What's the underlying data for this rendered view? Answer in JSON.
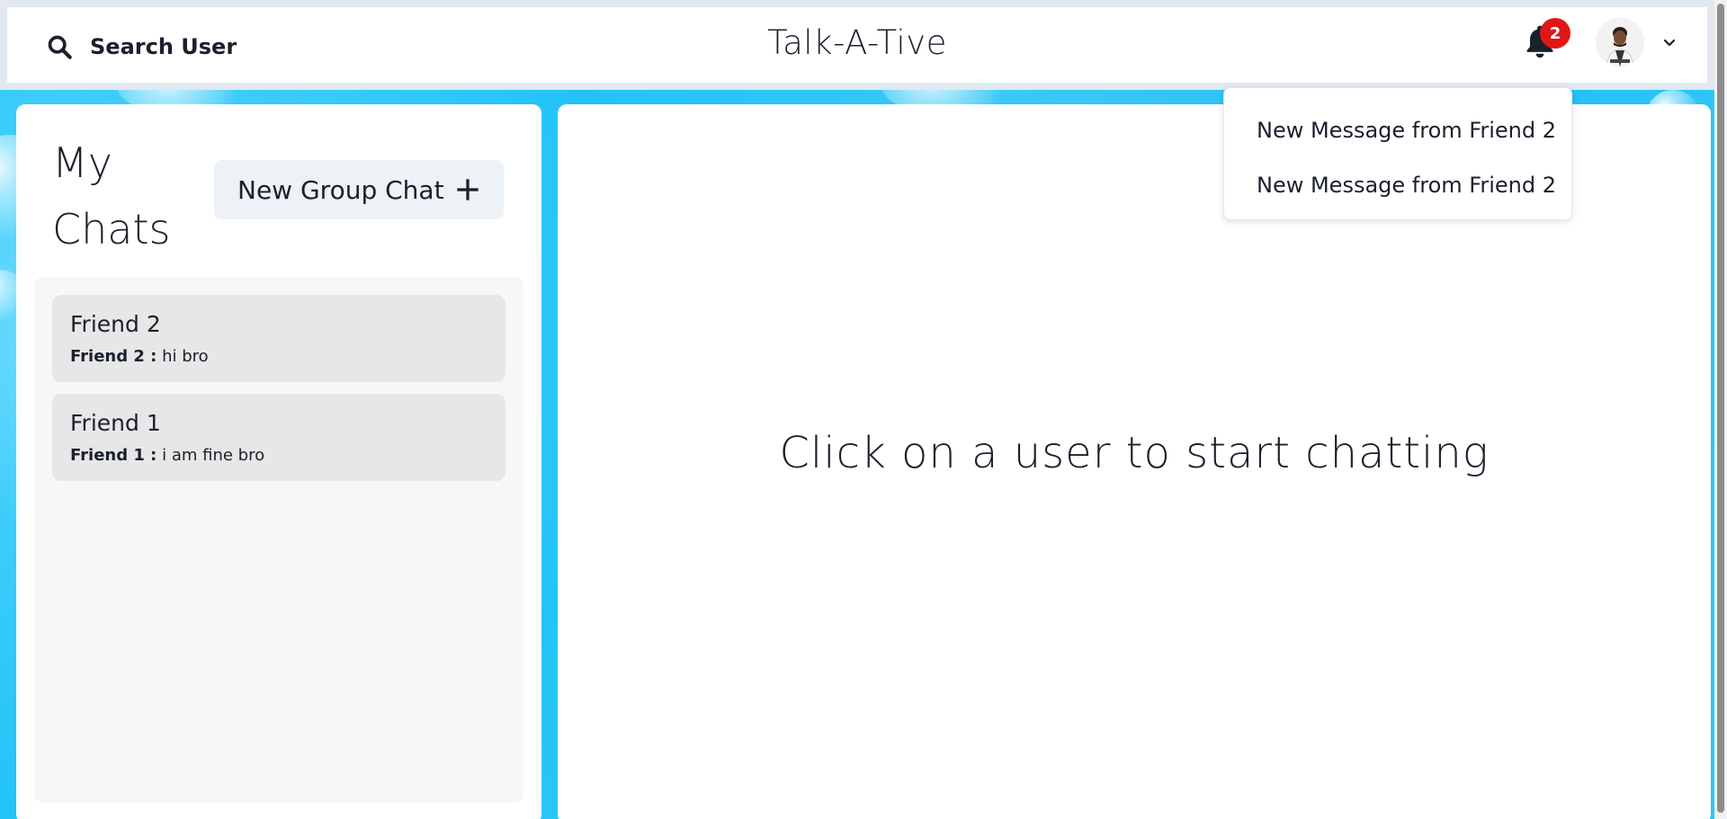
{
  "header": {
    "search_label": "Search User",
    "app_title": "Talk-A-Tive",
    "notification_count": "2"
  },
  "notifications": [
    {
      "label": "New Message from Friend 2"
    },
    {
      "label": "New Message from Friend 2"
    }
  ],
  "sidebar": {
    "title_line1": "My",
    "title_line2": "Chats",
    "new_group_label": "New Group Chat",
    "chats": [
      {
        "name": "Friend 2",
        "sender": "Friend 2 :",
        "message": "hi bro"
      },
      {
        "name": "Friend 1",
        "sender": "Friend 1 :",
        "message": "i am fine bro"
      }
    ]
  },
  "main": {
    "empty_message": "Click on a user to start chatting"
  },
  "colors": {
    "badge": "#e11616",
    "chat_item_bg": "#e7e7e7",
    "button_bg": "#edf2f7"
  }
}
